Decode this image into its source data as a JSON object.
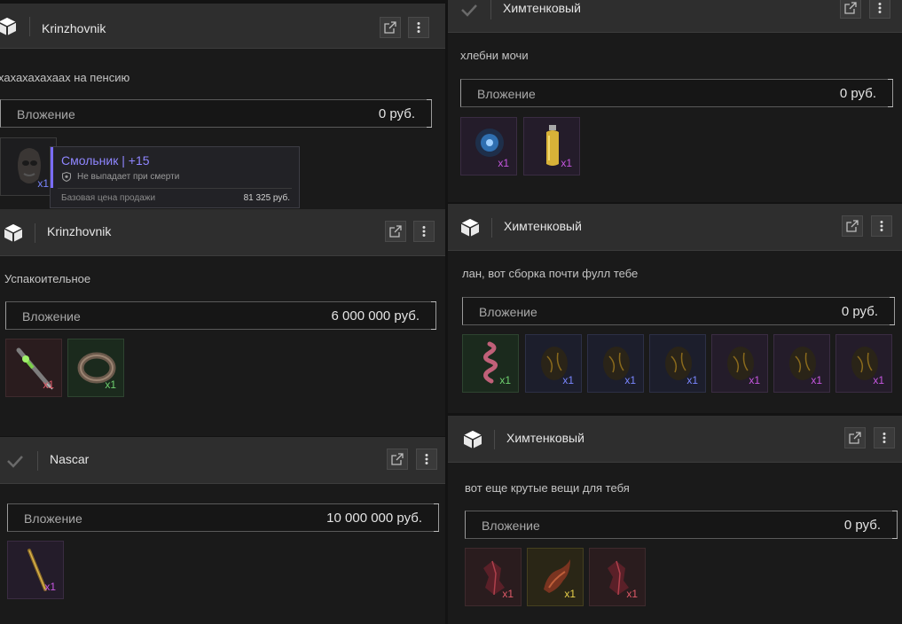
{
  "colors": {
    "count_red": "#e05a68",
    "count_green": "#6fd06f",
    "count_blue": "#7a86ff",
    "count_purple": "#c657e0",
    "count_gold": "#e8d04a"
  },
  "cards": [
    {
      "sender": "Krinzhovnik",
      "message": "хахахахахаах на пенсию",
      "investment_label": "Вложение",
      "investment_value": "0 руб.",
      "items": [
        {
          "icon": "face-mask-icon",
          "count": "x1"
        }
      ]
    },
    {
      "sender": "Krinzhovnik",
      "message": "Успакоительное",
      "investment_label": "Вложение",
      "investment_value": "6 000 000 руб.",
      "items": [
        {
          "icon": "syringe-icon",
          "count": "x1"
        },
        {
          "icon": "ring-artifact-icon",
          "count": "x1"
        }
      ]
    },
    {
      "sender": "Nascar",
      "message": "",
      "investment_label": "Вложение",
      "investment_value": "10 000 000 руб.",
      "items": [
        {
          "icon": "rod-artifact-icon",
          "count": "x1"
        }
      ]
    },
    {
      "sender": "Химтенковый",
      "message": "хлебни мочи",
      "investment_label": "Вложение",
      "investment_value": "0 руб.",
      "items": [
        {
          "icon": "blue-orb-artifact-icon",
          "count": "x1"
        },
        {
          "icon": "yellow-bottle-icon",
          "count": "x1"
        }
      ]
    },
    {
      "sender": "Химтенковый",
      "message": "лан, вот сборка почти фулл тебе",
      "investment_label": "Вложение",
      "investment_value": "0 руб.",
      "items": [
        {
          "icon": "coil-artifact-icon",
          "count": "x1"
        },
        {
          "icon": "dark-egg-artifact-icon",
          "count": "x1"
        },
        {
          "icon": "dark-egg-artifact-icon",
          "count": "x1"
        },
        {
          "icon": "dark-egg-artifact-icon",
          "count": "x1"
        },
        {
          "icon": "dark-egg-artifact-icon",
          "count": "x1"
        },
        {
          "icon": "dark-egg-artifact-icon",
          "count": "x1"
        },
        {
          "icon": "dark-egg-artifact-icon",
          "count": "x1"
        }
      ]
    },
    {
      "sender": "Химтенковый",
      "message": "вот еще крутые вещи для тебя",
      "investment_label": "Вложение",
      "investment_value": "0 руб.",
      "items": [
        {
          "icon": "red-crystal-artifact-icon",
          "count": "x1"
        },
        {
          "icon": "red-flame-artifact-icon",
          "count": "x1"
        },
        {
          "icon": "red-crystal-artifact-icon",
          "count": "x1"
        }
      ]
    }
  ],
  "tooltip": {
    "title": "Смольник | +15",
    "no_drop": "Не выпадает при смерти",
    "price_label": "Базовая цена продажи",
    "price_value": "81 325 руб."
  }
}
